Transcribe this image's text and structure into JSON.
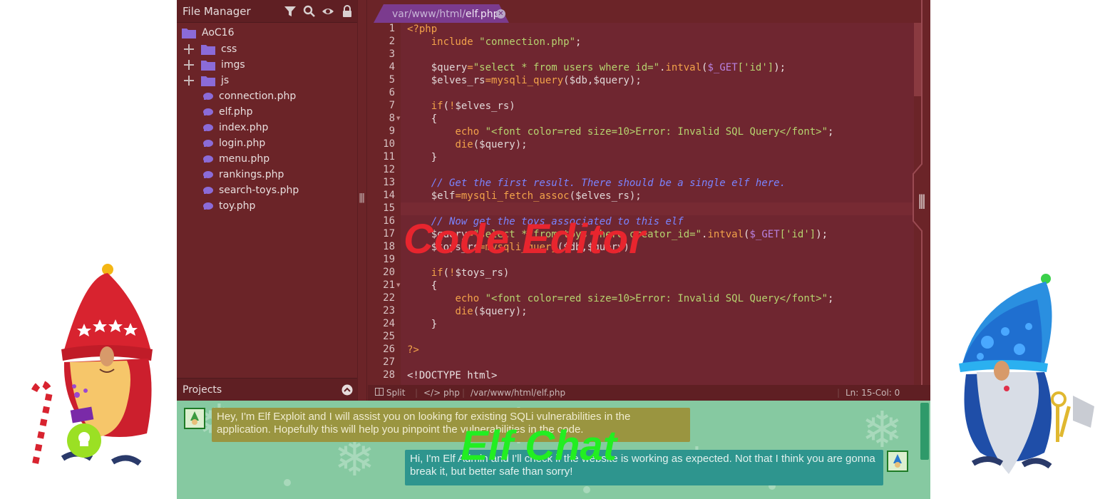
{
  "file_manager": {
    "title": "File Manager",
    "root": "AoC16",
    "folders": [
      "css",
      "imgs",
      "js"
    ],
    "files": [
      "connection.php",
      "elf.php",
      "index.php",
      "login.php",
      "menu.php",
      "rankings.php",
      "search-toys.php",
      "toy.php"
    ],
    "footer": "Projects"
  },
  "editor": {
    "tab_path": "var/www/html/",
    "tab_file": "elf.php",
    "watermark": "Code Editor",
    "line_numbers": [
      "1",
      "2",
      "3",
      "4",
      "5",
      "6",
      "7",
      "8",
      "9",
      "10",
      "11",
      "12",
      "13",
      "14",
      "15",
      "16",
      "17",
      "18",
      "19",
      "20",
      "21",
      "22",
      "23",
      "24",
      "25",
      "26",
      "27",
      "28"
    ],
    "code": {
      "l1": "<?php",
      "l2a": "include ",
      "l2b": "\"connection.php\"",
      "l2c": ";",
      "l4a": "$query",
      "l4b": "=",
      "l4c": "\"select * from users where id=\"",
      "l4d": ".",
      "l4e": "intval",
      "l4f": "(",
      "l4g": "$_GET",
      "l4h": "['id']",
      "l4i": ");",
      "l5a": "$elves_rs",
      "l5b": "=",
      "l5c": "mysqli_query",
      "l5d": "($db,$query);",
      "l7a": "if",
      "l7b": "(",
      "l7c": "!",
      "l7d": "$elves_rs)",
      "l8": "{",
      "l9a": "echo ",
      "l9b": "\"<font color=red size=10>Error: Invalid SQL Query</font>\"",
      "l9c": ";",
      "l10a": "die",
      "l10b": "($query);",
      "l11": "}",
      "l13": "// Get the first result. There should be a single elf here.",
      "l14a": "$elf",
      "l14b": "=",
      "l14c": "mysqli_fetch_assoc",
      "l14d": "($elves_rs);",
      "l16": "// Now get the toys associated to this elf",
      "l17a": "$query",
      "l17b": "=",
      "l17c": "\"select * from toys where creator_id=\"",
      "l17d": ".",
      "l17e": "intval",
      "l17f": "(",
      "l17g": "$_GET",
      "l17h": "['id']",
      "l17i": ");",
      "l18a": "$toys_rs",
      "l18b": "=",
      "l18c": "mysqli_query",
      "l18d": "($db,$query);",
      "l20a": "if",
      "l20b": "(",
      "l20c": "!",
      "l20d": "$toys_rs)",
      "l21": "{",
      "l22a": "echo ",
      "l22b": "\"<font color=red size=10>Error: Invalid SQL Query</font>\"",
      "l22c": ";",
      "l23a": "die",
      "l23b": "($query);",
      "l24": "}",
      "l26": "?>",
      "l28": "<!DOCTYPE html>"
    }
  },
  "statusbar": {
    "split": "Split",
    "lang": "php",
    "path": "/var/www/html/elf.php",
    "position": "Ln: 15-Col: 0"
  },
  "chat": {
    "watermark": "Elf Chat",
    "messages": [
      {
        "sender": "Elf Exploit",
        "text": "Hey, I'm Elf Exploit and I will assist you on looking for existing SQLi vulnerabilities in the application. Hopefully this will help you pinpoint the vulnerabilities in the code."
      },
      {
        "sender": "Elf Admin",
        "text": "Hi, I'm Elf Admin and I'll check if the website is working as expected. Not that I think you are gonna break it, but better safe than sorry!"
      }
    ]
  },
  "colors": {
    "app_bg": "#6b2428",
    "chat_bg": "#86c9a1",
    "msg_exploit": "#9a9540",
    "msg_admin": "#2e958e",
    "watermark_code": "#e8252e",
    "watermark_chat": "#22ee22"
  }
}
